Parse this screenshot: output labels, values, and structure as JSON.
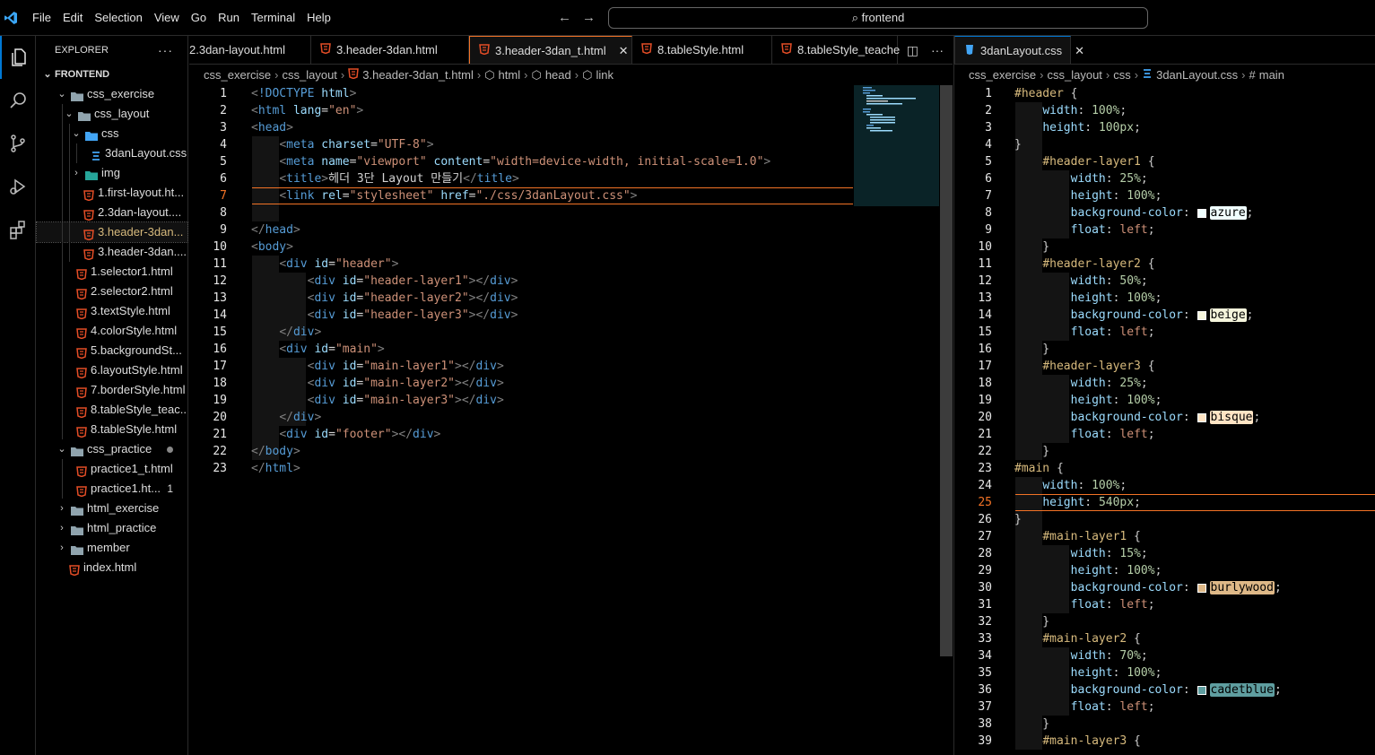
{
  "menu": [
    "File",
    "Edit",
    "Selection",
    "View",
    "Go",
    "Run",
    "Terminal",
    "Help"
  ],
  "command_center": "frontend",
  "explorer": {
    "title": "EXPLORER",
    "root": "FRONTEND",
    "items": [
      {
        "label": "css_exercise",
        "type": "folder",
        "depth": 1,
        "open": true
      },
      {
        "label": "css_layout",
        "type": "folder",
        "depth": 2,
        "open": true
      },
      {
        "label": "css",
        "type": "folder-css",
        "depth": 3,
        "open": true
      },
      {
        "label": "3danLayout.css",
        "type": "css",
        "depth": 4
      },
      {
        "label": "img",
        "type": "folder-img",
        "depth": 3,
        "open": false
      },
      {
        "label": "1.first-layout.ht...",
        "type": "html",
        "depth": 3
      },
      {
        "label": "2.3dan-layout....",
        "type": "html",
        "depth": 3
      },
      {
        "label": "3.header-3dan...",
        "type": "html",
        "depth": 3,
        "selected": true
      },
      {
        "label": "3.header-3dan....",
        "type": "html",
        "depth": 3
      },
      {
        "label": "1.selector1.html",
        "type": "html",
        "depth": 2
      },
      {
        "label": "2.selector2.html",
        "type": "html",
        "depth": 2
      },
      {
        "label": "3.textStyle.html",
        "type": "html",
        "depth": 2
      },
      {
        "label": "4.colorStyle.html",
        "type": "html",
        "depth": 2
      },
      {
        "label": "5.backgroundSt...",
        "type": "html",
        "depth": 2
      },
      {
        "label": "6.layoutStyle.html",
        "type": "html",
        "depth": 2
      },
      {
        "label": "7.borderStyle.html",
        "type": "html",
        "depth": 2
      },
      {
        "label": "8.tableStyle_teac...",
        "type": "html",
        "depth": 2
      },
      {
        "label": "8.tableStyle.html",
        "type": "html",
        "depth": 2
      },
      {
        "label": "css_practice",
        "type": "folder",
        "depth": 1,
        "open": true,
        "dot": true
      },
      {
        "label": "practice1_t.html",
        "type": "html",
        "depth": 2
      },
      {
        "label": "practice1.ht...",
        "type": "html",
        "depth": 2,
        "badge": "1"
      },
      {
        "label": "html_exercise",
        "type": "folder",
        "depth": 1,
        "open": false
      },
      {
        "label": "html_practice",
        "type": "folder",
        "depth": 1,
        "open": false
      },
      {
        "label": "member",
        "type": "folder",
        "depth": 1,
        "open": false
      },
      {
        "label": "index.html",
        "type": "html",
        "depth": 1
      }
    ]
  },
  "left_group": {
    "tabs": [
      {
        "label": "2.3dan-layout.html",
        "icon": "none",
        "width": 136
      },
      {
        "label": "3.header-3dan.html",
        "icon": "html",
        "width": 176
      },
      {
        "label": "3.header-3dan_t.html",
        "icon": "html",
        "width": 182,
        "active": true,
        "close": "✕"
      },
      {
        "label": "8.tableStyle.html",
        "icon": "html",
        "width": 156
      },
      {
        "label": "8.tableStyle_teache",
        "icon": "html",
        "width": 140
      }
    ],
    "breadcrumb": [
      "css_exercise",
      "css_layout",
      "3.header-3dan_t.html",
      "html",
      "head",
      "link"
    ],
    "code": [
      "<!DOCTYPE html>",
      "<html lang=\"en\">",
      "<head>",
      "    <meta charset=\"UTF-8\">",
      "    <meta name=\"viewport\" content=\"width=device-width, initial-scale=1.0\">",
      "    <title>헤더 3단 Layout 만들기</title>",
      "    <link rel=\"stylesheet\" href=\"./css/3danLayout.css\">",
      "",
      "</head>",
      "<body>",
      "    <div id=\"header\">",
      "        <div id=\"header-layer1\"></div>",
      "        <div id=\"header-layer2\"></div>",
      "        <div id=\"header-layer3\"></div>",
      "    </div>",
      "    <div id=\"main\">",
      "        <div id=\"main-layer1\"></div>",
      "        <div id=\"main-layer2\"></div>",
      "        <div id=\"main-layer3\"></div>",
      "    </div>",
      "    <div id=\"footer\"></div>",
      "</body>",
      "</html>"
    ],
    "current_line": 7
  },
  "right_group": {
    "tab": {
      "label": "3danLayout.css",
      "close": "✕"
    },
    "breadcrumb": [
      "css_exercise",
      "css_layout",
      "css",
      "3danLayout.css",
      "#main"
    ],
    "code": [
      "#header {",
      "    width: 100%;",
      "    height: 100px;",
      "}",
      "    #header-layer1 {",
      "        width: 25%;",
      "        height: 100%;",
      "        background-color: azure;",
      "        float: left;",
      "    }",
      "    #header-layer2 {",
      "        width: 50%;",
      "        height: 100%;",
      "        background-color: beige;",
      "        float: left;",
      "    }",
      "    #header-layer3 {",
      "        width: 25%;",
      "        height: 100%;",
      "        background-color: bisque;",
      "        float: left;",
      "    }",
      "#main {",
      "    width: 100%;",
      "    height: 540px;",
      "}",
      "    #main-layer1 {",
      "        width: 15%;",
      "        height: 100%;",
      "        background-color: burlywood;",
      "        float: left;",
      "    }",
      "    #main-layer2 {",
      "        width: 70%;",
      "        height: 100%;",
      "        background-color: cadetblue;",
      "        float: left;",
      "    }",
      "    #main-layer3 {"
    ],
    "current_line": 25,
    "colors": {
      "azure": "#f0ffff",
      "beige": "#f5f5dc",
      "bisque": "#ffe4c4",
      "burlywood": "#deb887",
      "cadetblue": "#5f9ea0"
    }
  },
  "colors": {
    "accent": "#0078d4",
    "tab_border": "#f37326",
    "html_icon": "#e44d26",
    "css_icon": "#42a5f5"
  }
}
